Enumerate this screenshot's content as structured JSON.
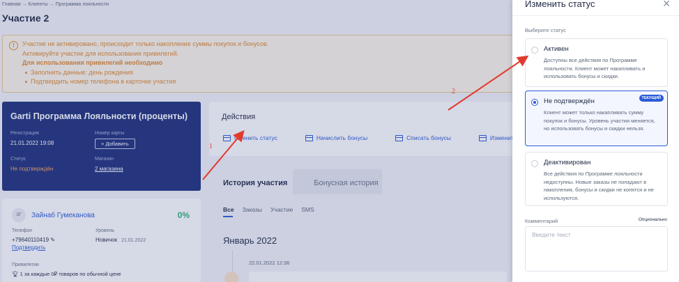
{
  "breadcrumb": "Главная → Клиенты → Программа лояльности",
  "page_title": "Участие 2",
  "alert": {
    "line1": "Участие не активировано, происходит только накопление суммы покупок и бонусов.",
    "line2": "Активируйте участие для использования привилегий.",
    "line3": "Для использования привилегий необходимо",
    "items": [
      "Заполнить данные: день рождения",
      "Подтвердить номер телефона в карточке участия"
    ]
  },
  "program_card": {
    "title": "Garti Программа Лояльности (проценты)",
    "reg_label": "Регистрация",
    "reg_value": "21.01.2022 19:08",
    "card_label": "Номер карты",
    "add_button": "+ Добавить",
    "status_label": "Статус",
    "status_value": "Не подтверждён",
    "store_label": "Магазин",
    "store_value": "2 магазина"
  },
  "actions": {
    "title": "Действия",
    "items": [
      "Сменить статус",
      "Начислить бонусы",
      "Списать бонусы",
      "Изменить ур"
    ]
  },
  "client_card": {
    "initials": "ЗГ",
    "name": "Зайнаб Гумеканова",
    "percent": "0%",
    "phone_label": "Телефон",
    "phone_value": "+79640110419",
    "confirm_link": "Подтвердить",
    "level_label": "Уровень",
    "level_value": "Новичок",
    "level_date": "21.01.2022",
    "priv_label": "Привилегии",
    "priv_item": "1 за каждые 0₽ товаров по обычной цене"
  },
  "history_tabs": [
    "История участия",
    "Бонусная история"
  ],
  "sub_tabs": [
    "Все",
    "Заказы",
    "Участие",
    "SMS"
  ],
  "month": "Январь 2022",
  "history_date": "22.01.2022 12:36",
  "drawer": {
    "title": "Изменить статус",
    "close": "✕",
    "section_label": "Выберите статус",
    "options": [
      {
        "title": "Активен",
        "desc": "Доступны все действия по Программе лояльности. Клиент может накапливать и использовать бонусы и скидки."
      },
      {
        "title": "Не подтверждён",
        "badge": "ТЕКУЩИЙ",
        "desc": "Клиент может только накапливать сумму покупок и бонусы. Уровень участия меняется, но использовать бонусы и скидки нельзя."
      },
      {
        "title": "Деактивирован",
        "desc": "Все действия по Программе лояльности недоступны. Новые заказы не попадают в накопления, бонусы и скидки не копятся и не используются."
      }
    ],
    "comment_label": "Комментарий",
    "optional_label": "Опционально",
    "comment_placeholder": "Введите текст"
  },
  "annotations": {
    "label1": "1",
    "label2": "2",
    "color": "#e23a2e"
  }
}
